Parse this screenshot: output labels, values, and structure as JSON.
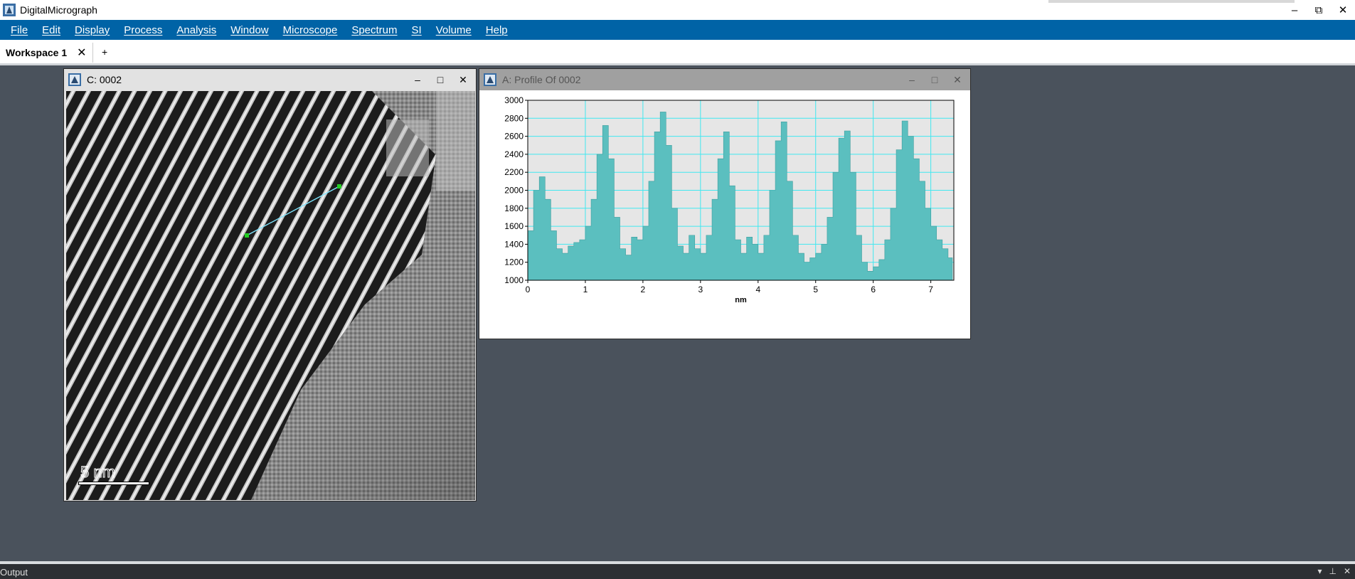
{
  "app": {
    "title": "DigitalMicrograph",
    "window_controls": [
      "–",
      "⧉",
      "✕"
    ]
  },
  "menu": {
    "items": [
      "File",
      "Edit",
      "Display",
      "Process",
      "Analysis",
      "Window",
      "Microscope",
      "Spectrum",
      "SI",
      "Volume",
      "Help"
    ]
  },
  "tabs": {
    "active_label": "Workspace 1",
    "close": "✕",
    "add": "+"
  },
  "image_window": {
    "title": "C: 0002",
    "controls": [
      "–",
      "□",
      "✕"
    ],
    "scale_bar_label": "5 nm",
    "line_profile_color": "#7fe6ff",
    "handle_color": "#22cc22"
  },
  "profile_window": {
    "title": "A: Profile Of 0002",
    "controls": [
      "–",
      "□",
      "✕"
    ],
    "colors": {
      "fill": "#5bbfbf",
      "grid": "#40e8f0",
      "plot_bg": "#e6e6e6"
    }
  },
  "chart_data": {
    "type": "area",
    "xlabel": "nm",
    "ylabel": "",
    "xlim": [
      0,
      7.4
    ],
    "ylim": [
      1000,
      3000
    ],
    "xticks": [
      0,
      1,
      2,
      3,
      4,
      5,
      6,
      7
    ],
    "yticks": [
      1000,
      1200,
      1400,
      1600,
      1800,
      2000,
      2200,
      2400,
      2600,
      2800,
      3000
    ],
    "grid": true,
    "x": [
      0,
      0.1,
      0.2,
      0.3,
      0.4,
      0.5,
      0.6,
      0.7,
      0.8,
      0.9,
      1.0,
      1.1,
      1.2,
      1.3,
      1.4,
      1.5,
      1.6,
      1.7,
      1.8,
      1.9,
      2.0,
      2.1,
      2.2,
      2.3,
      2.4,
      2.5,
      2.6,
      2.7,
      2.8,
      2.9,
      3.0,
      3.1,
      3.2,
      3.3,
      3.4,
      3.5,
      3.6,
      3.7,
      3.8,
      3.9,
      4.0,
      4.1,
      4.2,
      4.3,
      4.4,
      4.5,
      4.6,
      4.7,
      4.8,
      4.9,
      5.0,
      5.1,
      5.2,
      5.3,
      5.4,
      5.5,
      5.6,
      5.7,
      5.8,
      5.9,
      6.0,
      6.1,
      6.2,
      6.3,
      6.4,
      6.5,
      6.6,
      6.7,
      6.8,
      6.9,
      7.0,
      7.1,
      7.2,
      7.3,
      7.35
    ],
    "y": [
      1550,
      2000,
      2150,
      1900,
      1550,
      1350,
      1300,
      1380,
      1420,
      1450,
      1600,
      1900,
      2400,
      2720,
      2350,
      1700,
      1350,
      1280,
      1480,
      1450,
      1600,
      2100,
      2650,
      2870,
      2500,
      1800,
      1380,
      1300,
      1500,
      1350,
      1300,
      1500,
      1900,
      2350,
      2650,
      2050,
      1450,
      1300,
      1480,
      1400,
      1300,
      1500,
      2000,
      2550,
      2760,
      2100,
      1500,
      1300,
      1200,
      1250,
      1300,
      1400,
      1700,
      2200,
      2580,
      2660,
      2200,
      1500,
      1200,
      1100,
      1150,
      1230,
      1450,
      1800,
      2450,
      2770,
      2600,
      2350,
      2100,
      1800,
      1600,
      1450,
      1350,
      1250,
      1250
    ]
  }
}
